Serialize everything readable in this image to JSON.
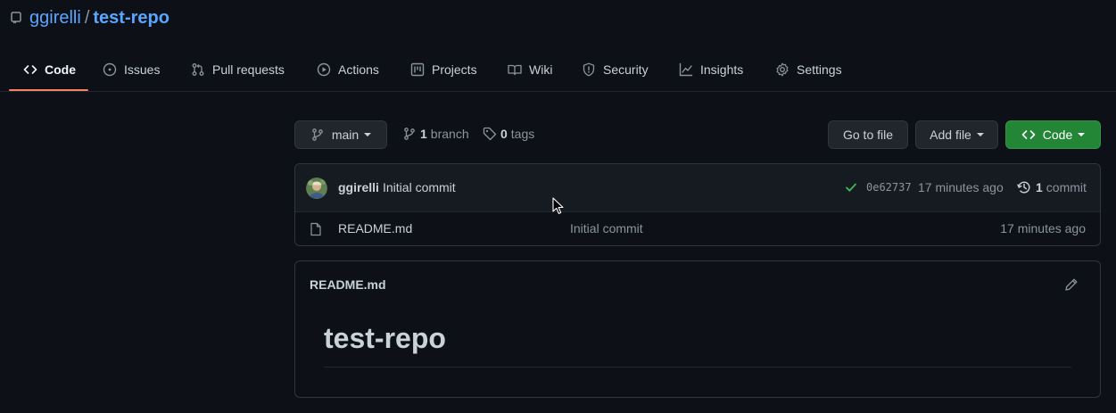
{
  "repo": {
    "owner": "ggirelli",
    "separator": "/",
    "name": "test-repo"
  },
  "tabs": [
    {
      "label": "Code",
      "icon": "code-icon",
      "active": true
    },
    {
      "label": "Issues",
      "icon": "issue-icon"
    },
    {
      "label": "Pull requests",
      "icon": "pull-request-icon"
    },
    {
      "label": "Actions",
      "icon": "play-icon"
    },
    {
      "label": "Projects",
      "icon": "project-icon"
    },
    {
      "label": "Wiki",
      "icon": "book-icon"
    },
    {
      "label": "Security",
      "icon": "shield-icon"
    },
    {
      "label": "Insights",
      "icon": "graph-icon"
    },
    {
      "label": "Settings",
      "icon": "gear-icon"
    }
  ],
  "toolbar": {
    "branch_selector": "main",
    "branch_count": "1",
    "branch_label": "branch",
    "tag_count": "0",
    "tag_label": "tags",
    "go_to_file": "Go to file",
    "add_file": "Add file",
    "code_button": "Code"
  },
  "latest_commit": {
    "author": "ggirelli",
    "message": "Initial commit",
    "sha": "0e62737",
    "time": "17 minutes ago",
    "commit_count": "1",
    "commit_label": "commit"
  },
  "files": [
    {
      "name": "README.md",
      "message": "Initial commit",
      "time": "17 minutes ago",
      "icon": "file-icon"
    }
  ],
  "readme": {
    "filename": "README.md",
    "heading": "test-repo"
  },
  "colors": {
    "background": "#0d1117",
    "accent_link": "#58a6ff",
    "active_tab_underline": "#f78166",
    "primary_button": "#238636",
    "success_check": "#3fb950"
  }
}
